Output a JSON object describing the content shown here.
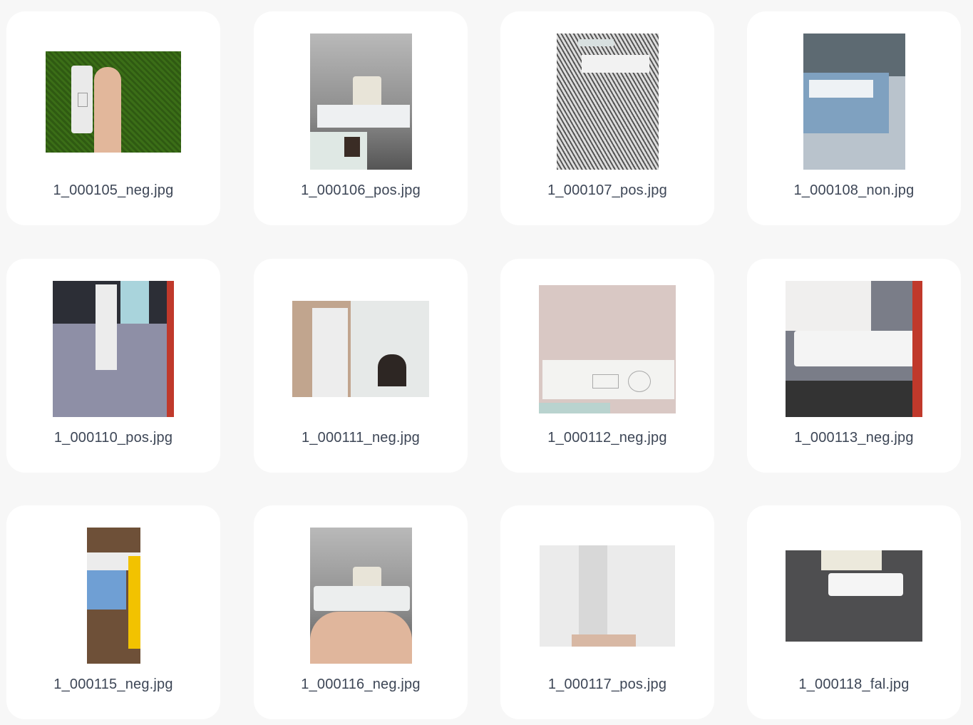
{
  "files": [
    {
      "name": "1_000105_neg.jpg",
      "label": "neg"
    },
    {
      "name": "1_000106_pos.jpg",
      "label": "pos"
    },
    {
      "name": "1_000107_pos.jpg",
      "label": "pos"
    },
    {
      "name": "1_000108_non.jpg",
      "label": "non"
    },
    {
      "name": "1_000110_pos.jpg",
      "label": "pos"
    },
    {
      "name": "1_000111_neg.jpg",
      "label": "neg"
    },
    {
      "name": "1_000112_neg.jpg",
      "label": "neg"
    },
    {
      "name": "1_000113_neg.jpg",
      "label": "neg"
    },
    {
      "name": "1_000115_neg.jpg",
      "label": "neg"
    },
    {
      "name": "1_000116_neg.jpg",
      "label": "neg"
    },
    {
      "name": "1_000117_pos.jpg",
      "label": "pos"
    },
    {
      "name": "1_000118_fal.jpg",
      "label": "fal"
    }
  ]
}
